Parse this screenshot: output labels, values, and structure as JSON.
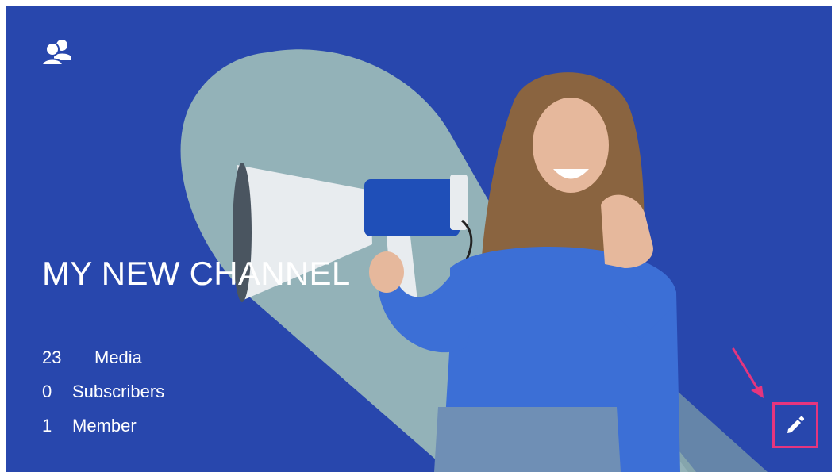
{
  "channel": {
    "title": "MY NEW CHANNEL",
    "icon": "users-icon",
    "stats": [
      {
        "value": "23",
        "label": "Media"
      },
      {
        "value": "0",
        "label": "Subscribers"
      },
      {
        "value": "1",
        "label": "Member"
      }
    ]
  },
  "edit": {
    "icon": "pencil-icon",
    "highlight_color": "#e5357e"
  },
  "colors": {
    "banner": "#2847ad",
    "swoosh": "#93b2b8",
    "text": "#ffffff"
  }
}
